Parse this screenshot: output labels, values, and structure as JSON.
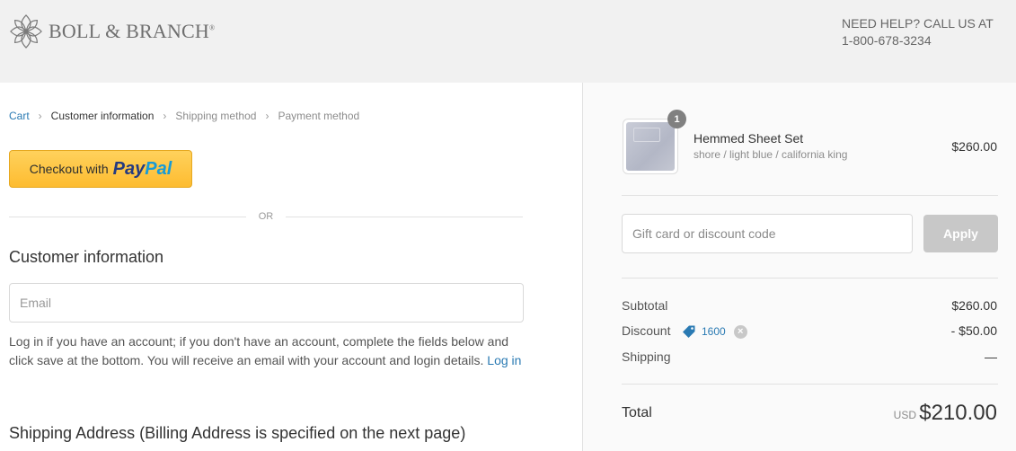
{
  "header": {
    "brand": "BOLL & BRANCH",
    "brand_mark": "®",
    "help_line1": "NEED HELP? CALL US AT",
    "help_line2": "1-800-678-3234"
  },
  "breadcrumb": {
    "items": [
      "Cart",
      "Customer information",
      "Shipping method",
      "Payment method"
    ],
    "current_index": 1
  },
  "paypal": {
    "prefix": "Checkout with",
    "pay": "Pay",
    "pal": "Pal"
  },
  "divider_text": "OR",
  "customer": {
    "heading": "Customer information",
    "email_placeholder": "Email",
    "login_note": "Log in if you have an account; if you don't have an account, complete the fields below and click save at the bottom. You will receive an email with your account and login details.",
    "login_link": "Log in"
  },
  "shipping_heading": "Shipping Address (Billing Address is specified on the next page)",
  "order": {
    "item": {
      "quantity": "1",
      "name": "Hemmed Sheet Set",
      "variant": "shore / light blue / california king",
      "price": "$260.00"
    },
    "discount_placeholder": "Gift card or discount code",
    "apply_label": "Apply",
    "subtotal_label": "Subtotal",
    "subtotal_value": "$260.00",
    "discount_label": "Discount",
    "discount_code": "1600",
    "discount_value": "- $50.00",
    "shipping_label": "Shipping",
    "shipping_value": "—",
    "total_label": "Total",
    "total_currency": "USD",
    "total_value": "$210.00"
  },
  "colors": {
    "link": "#2a7ab3",
    "paypal_yellow": "#fdbc30",
    "paypal_navy": "#253b80",
    "paypal_cyan": "#179bd7",
    "apply_disabled": "#c8c8c8"
  }
}
